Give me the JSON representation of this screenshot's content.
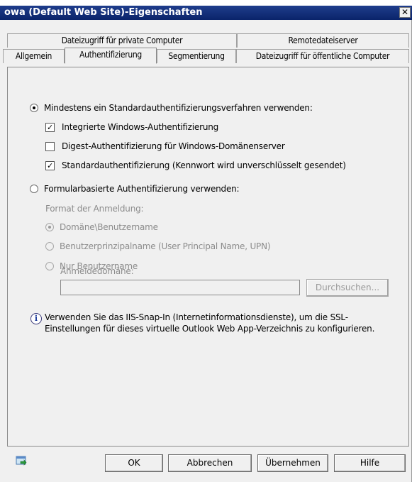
{
  "window": {
    "title": "owa (Default Web Site)-Eigenschaften",
    "close": "✕"
  },
  "tabs": {
    "row1": [
      "Dateizugriff für private Computer",
      "Remotedateiserver"
    ],
    "row2": [
      "Allgemein",
      "Authentifizierung",
      "Segmentierung",
      "Dateizugriff für öffentliche Computer"
    ],
    "active": "Authentifizierung"
  },
  "auth": {
    "standard_option": "Mindestens ein Standardauthentifizierungsverfahren verwenden:",
    "checks": [
      {
        "label": "Integrierte Windows-Authentifizierung",
        "checked": true
      },
      {
        "label": "Digest-Authentifizierung für Windows-Domänenserver",
        "checked": false
      },
      {
        "label": "Standardauthentifizierung (Kennwort wird unverschlüsselt gesendet)",
        "checked": true
      }
    ],
    "forms_option": "Formularbasierte Authentifizierung verwenden:",
    "format_label": "Format der Anmeldung:",
    "formats": [
      {
        "label": "Domäne\\Benutzername",
        "checked": true
      },
      {
        "label": "Benutzerprinzipalname (User Principal Name, UPN)",
        "checked": false
      },
      {
        "label": "Nur Benutzername",
        "checked": false
      }
    ],
    "logon_domain_label": "Anmeldedomäne:",
    "logon_domain_value": "",
    "browse_button": "Durchsuchen...",
    "info_text": "Verwenden Sie das IIS-Snap-In (Internetinformationsdienste), um die SSL-Einstellungen für dieses virtuelle Outlook Web App-Verzeichnis zu konfigurieren."
  },
  "footer": {
    "ok": "OK",
    "cancel": "Abbrechen",
    "apply": "Übernehmen",
    "help": "Hilfe"
  },
  "icons": {
    "info": "info-icon",
    "help_small": "help-icon"
  }
}
